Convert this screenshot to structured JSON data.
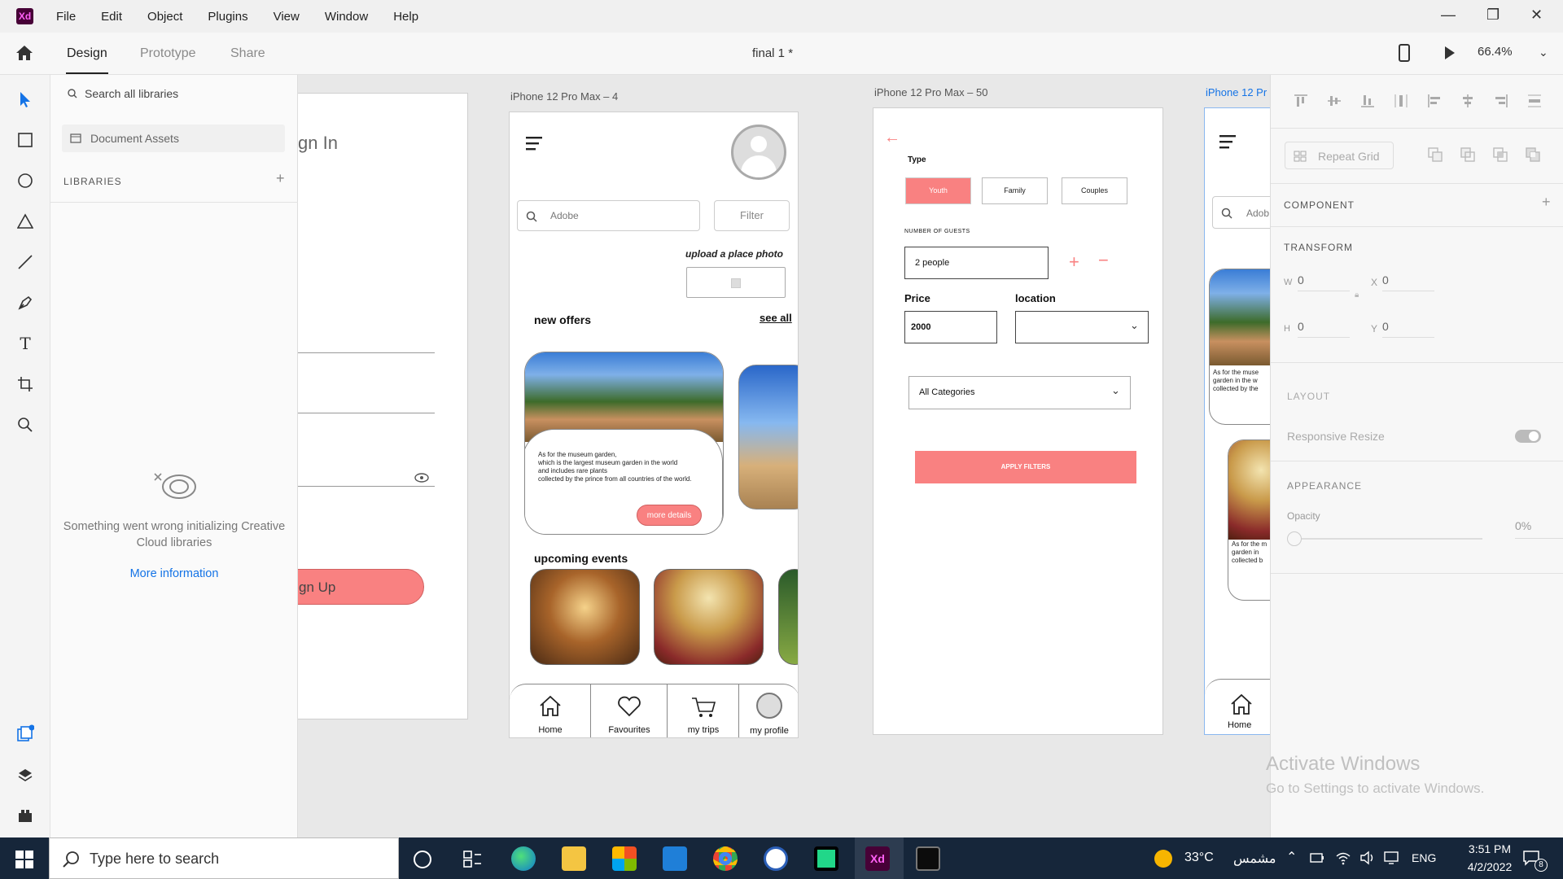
{
  "menubar": {
    "items": [
      "File",
      "Edit",
      "Object",
      "Plugins",
      "View",
      "Window",
      "Help"
    ]
  },
  "toolbar": {
    "tabs": [
      "Design",
      "Prototype",
      "Share"
    ],
    "doc_title": "final 1 *",
    "zoom": "66.4%"
  },
  "library": {
    "search_placeholder": "Search all libraries",
    "document_assets": "Document Assets",
    "libraries_label": "LIBRARIES",
    "error_text": "Something went wrong initializing Creative Cloud libraries",
    "more_info": "More information"
  },
  "artboard_signin": {
    "title": "gn In",
    "signup": "gn Up"
  },
  "artboard4": {
    "title": "iPhone 12 Pro Max – 4",
    "search_value": "Adobe",
    "filter": "Filter",
    "upload": "upload a place photo",
    "new_offers": "new offers",
    "see_all": "see all",
    "card_text_1": "As for the museum garden,",
    "card_text_2": "which is the largest museum garden in the world",
    "card_text_3": "and includes rare plants",
    "card_text_4": "collected by the prince from all countries of the world.",
    "more_details": "more details",
    "upcoming": "upcoming events",
    "nav": [
      "Home",
      "Favourites",
      "my trips",
      "my profile"
    ]
  },
  "artboard50": {
    "title": "iPhone 12 Pro Max – 50",
    "type_label": "Type",
    "types": [
      "Youth",
      "Family",
      "Couples"
    ],
    "guests_label": "NUMBER OF GUESTS",
    "guests_value": "2 people",
    "price_label": "Price",
    "location_label": "location",
    "price_value": "2000",
    "category": "All Categories",
    "apply": "APPLY FILTERS"
  },
  "artboard_partial": {
    "title": "iPhone 12 Pr",
    "search": "Adob",
    "text_a1": "As for the muse",
    "text_a2": "garden in the w",
    "text_a3": "collected by the",
    "text_b1": "As for the m",
    "text_b2": "garden in",
    "text_b3": "collected b",
    "home": "Home"
  },
  "rightpanel": {
    "repeat_grid": "Repeat Grid",
    "component": "COMPONENT",
    "transform": "TRANSFORM",
    "w_label": "W",
    "w": "0",
    "x_label": "X",
    "x": "0",
    "h_label": "H",
    "h": "0",
    "y_label": "Y",
    "y": "0",
    "layout": "LAYOUT",
    "responsive": "Responsive Resize",
    "appearance": "APPEARANCE",
    "opacity_label": "Opacity",
    "opacity": "0%",
    "watermark_1": "Activate Windows",
    "watermark_2": "Go to Settings to activate Windows."
  },
  "taskbar": {
    "search": "Type here to search",
    "temp": "33°C",
    "weather": "مشمس",
    "lang": "ENG",
    "time": "3:51 PM",
    "date": "4/2/2022",
    "notif": "8"
  },
  "colors": {
    "accent": "#f98181",
    "xd": "#470137",
    "taskbar": "#16263a"
  }
}
